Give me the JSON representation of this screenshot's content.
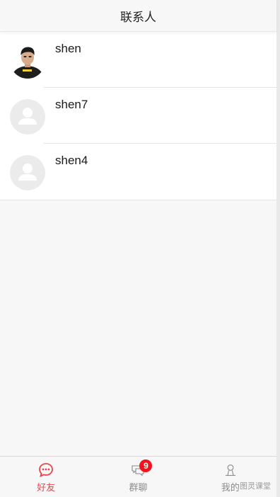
{
  "header": {
    "title": "联系人"
  },
  "contacts": [
    {
      "name": "shen",
      "avatar": "photo-avatar"
    },
    {
      "name": "shen7",
      "avatar": "default-avatar"
    },
    {
      "name": "shen4",
      "avatar": "default-avatar"
    }
  ],
  "tabbar": {
    "tabs": [
      {
        "label": "好友",
        "icon": "chat-bubble-icon",
        "active": true
      },
      {
        "label": "群聊",
        "icon": "group-chat-icon",
        "badge": "9"
      },
      {
        "label": "我的",
        "icon": "person-icon"
      }
    ]
  },
  "watermark": "图灵课堂",
  "colors": {
    "accent": "#e9454d",
    "badge": "#f4121d",
    "inactive": "#8a8a8a",
    "background": "#f7f7f7"
  }
}
